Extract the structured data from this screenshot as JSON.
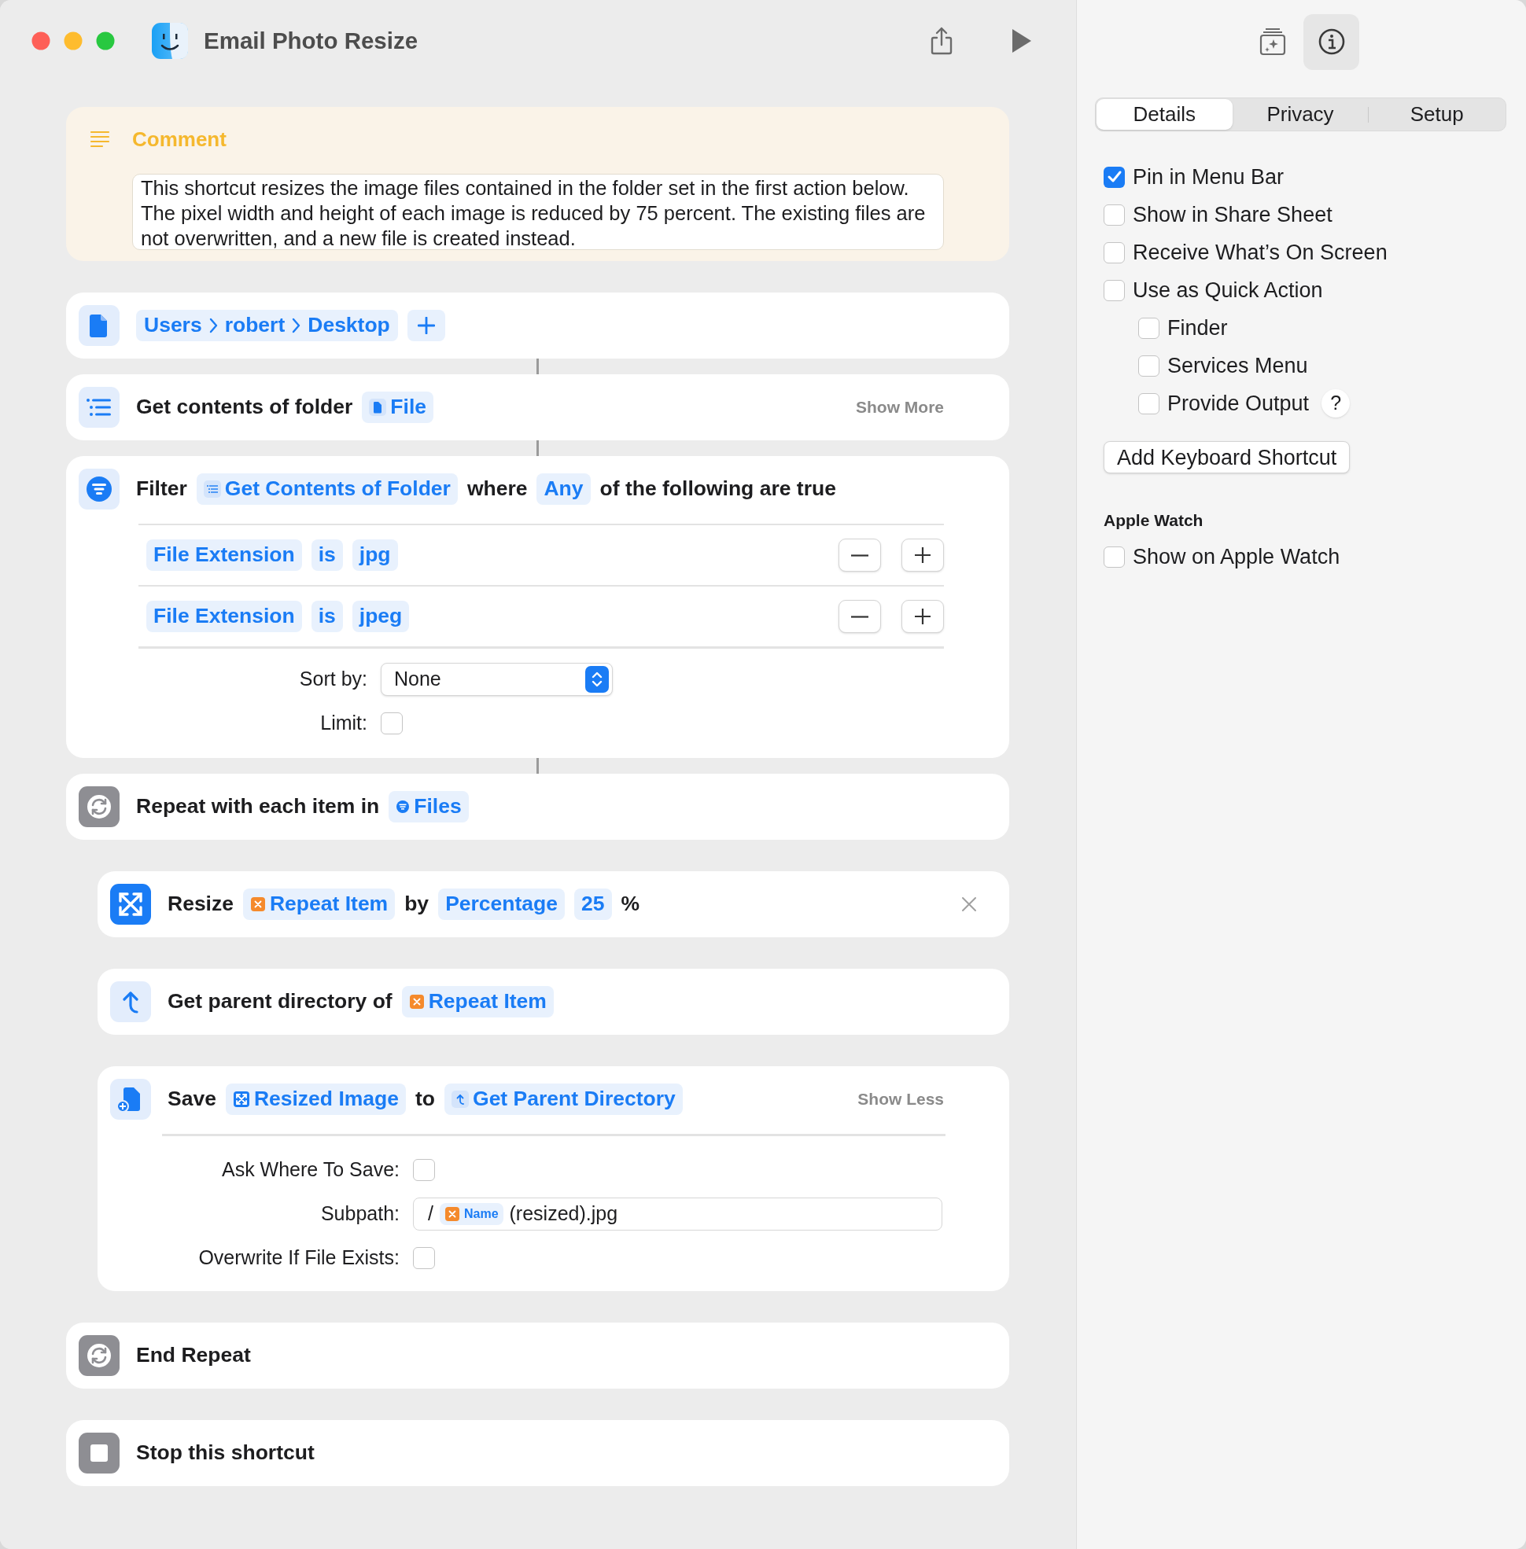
{
  "window": {
    "title": "Email Photo Resize"
  },
  "comment": {
    "title": "Comment",
    "text": "This shortcut resizes the image files contained in the folder set in the first action below. The pixel width and height of each image is reduced by 75 percent. The existing files are not overwritten, and a new file is created instead."
  },
  "actions": [
    {
      "kind": "folder",
      "nested": false,
      "connected": false,
      "closable": false,
      "parts": [
        {
          "kind": "path",
          "segments": [
            "Users",
            "robert",
            "Desktop"
          ]
        }
      ]
    },
    {
      "kind": "get_contents",
      "nested": false,
      "connected": true,
      "closable": false,
      "parts": [
        {
          "kind": "text",
          "text": "Get contents of folder"
        },
        {
          "kind": "file_token",
          "text": "File"
        }
      ],
      "link": "Show More"
    },
    {
      "kind": "filter",
      "nested": false,
      "connected": true,
      "closable": false,
      "parts": [
        {
          "kind": "text",
          "text": "Filter"
        },
        {
          "kind": "list_token",
          "text": "Get Contents of Folder"
        },
        {
          "kind": "text",
          "text": "where"
        },
        {
          "kind": "token",
          "text": "Any"
        },
        {
          "kind": "text",
          "text": "of the following are true"
        }
      ],
      "conditions": [
        {
          "field": "File Extension",
          "op": "is",
          "value": "jpg"
        },
        {
          "field": "File Extension",
          "op": "is",
          "value": "jpeg"
        }
      ],
      "fields": [
        {
          "kind": "select",
          "label": "Sort by:",
          "value": "None"
        },
        {
          "kind": "checkbox",
          "label": "Limit:",
          "checked": false
        }
      ]
    },
    {
      "kind": "repeat",
      "nested": false,
      "connected": true,
      "closable": false,
      "parts": [
        {
          "kind": "text",
          "text": "Repeat with each item in"
        },
        {
          "kind": "filter_token",
          "text": "Files"
        }
      ]
    },
    {
      "kind": "resize",
      "nested": true,
      "connected": false,
      "closable": true,
      "parts": [
        {
          "kind": "text",
          "text": "Resize"
        },
        {
          "kind": "variable_token",
          "text": "Repeat Item"
        },
        {
          "kind": "text",
          "text": "by"
        },
        {
          "kind": "token",
          "text": "Percentage"
        },
        {
          "kind": "token",
          "text": "25"
        },
        {
          "kind": "text",
          "text": "%"
        }
      ]
    },
    {
      "kind": "parent",
      "nested": true,
      "connected": false,
      "closable": false,
      "parts": [
        {
          "kind": "text",
          "text": "Get parent directory of"
        },
        {
          "kind": "variable_token",
          "text": "Repeat Item"
        }
      ]
    },
    {
      "kind": "save",
      "nested": true,
      "connected": false,
      "closable": false,
      "parts": [
        {
          "kind": "text",
          "text": "Save"
        },
        {
          "kind": "resize_token",
          "text": "Resized Image"
        },
        {
          "kind": "text",
          "text": "to"
        },
        {
          "kind": "parent_token",
          "text": "Get Parent Directory"
        }
      ],
      "link": "Show Less",
      "fields": [
        {
          "kind": "checkbox",
          "label": "Ask Where To Save:",
          "checked": false
        },
        {
          "kind": "path",
          "label": "Subpath:",
          "parts": [
            {
              "kind": "text",
              "text": "/"
            },
            {
              "kind": "variable_token",
              "text": "Name"
            },
            {
              "kind": "text",
              "text": "(resized).jpg"
            }
          ]
        },
        {
          "kind": "checkbox",
          "label": "Overwrite If File Exists:",
          "checked": false
        }
      ]
    },
    {
      "kind": "end_repeat",
      "nested": false,
      "connected": false,
      "closable": false,
      "parts": [
        {
          "kind": "text",
          "text": "End Repeat"
        }
      ]
    },
    {
      "kind": "stop",
      "nested": false,
      "connected": false,
      "closable": false,
      "parts": [
        {
          "kind": "text",
          "text": "Stop this shortcut"
        }
      ]
    }
  ],
  "sidebar": {
    "tabs": [
      {
        "label": "Details",
        "selected": true
      },
      {
        "label": "Privacy",
        "selected": false
      },
      {
        "label": "Setup",
        "selected": false
      }
    ],
    "options": [
      {
        "label": "Pin in Menu Bar",
        "checked": true
      },
      {
        "label": "Show in Share Sheet",
        "checked": false
      },
      {
        "label": "Receive What’s On Screen",
        "checked": false
      },
      {
        "label": "Use as Quick Action",
        "checked": false,
        "children": [
          {
            "label": "Finder",
            "checked": false
          },
          {
            "label": "Services Menu",
            "checked": false
          },
          {
            "label": "Provide Output",
            "checked": false,
            "help": "?"
          }
        ]
      }
    ],
    "button": "Add Keyboard Shortcut",
    "sections": [
      {
        "title": "Apple Watch",
        "options": [
          {
            "label": "Show on Apple Watch",
            "checked": false
          }
        ]
      }
    ]
  }
}
